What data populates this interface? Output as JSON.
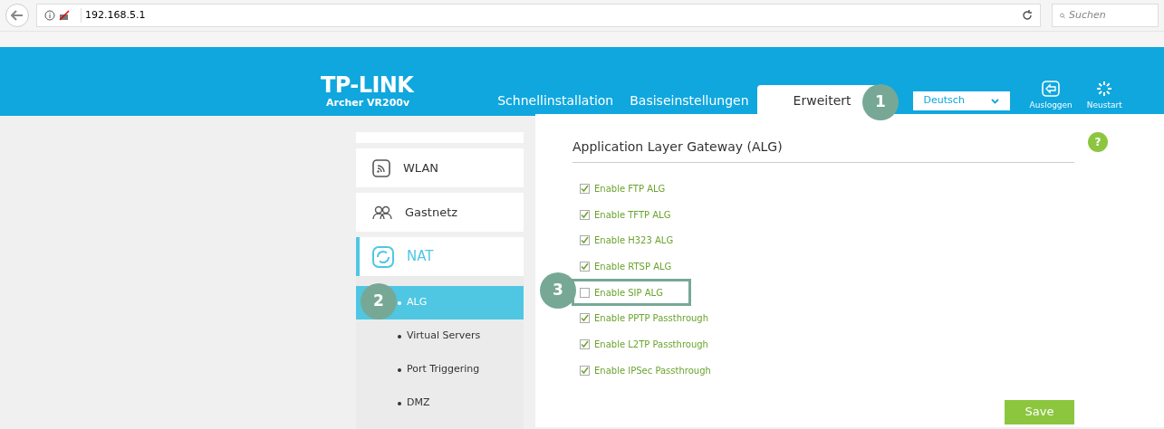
{
  "browser": {
    "url": "192.168.5.1",
    "search_placeholder": "Suchen"
  },
  "header": {
    "logo": "TP-LINK",
    "model": "Archer VR200v",
    "tabs": [
      {
        "label": "Schnellinstallation",
        "selected": false
      },
      {
        "label": "Basiseinstellungen",
        "selected": false
      },
      {
        "label": "Erweitert",
        "selected": true
      }
    ],
    "language": "Deutsch",
    "actions": [
      {
        "kind": "logout",
        "label": "Ausloggen"
      },
      {
        "kind": "reboot",
        "label": "Neustart"
      }
    ]
  },
  "sidebar": {
    "items": [
      {
        "kind": "partial"
      },
      {
        "kind": "wlan",
        "label": "WLAN",
        "active": false
      },
      {
        "kind": "guest",
        "label": "Gastnetz",
        "active": false
      },
      {
        "kind": "nat",
        "label": "NAT",
        "active": true,
        "children": [
          {
            "label": "ALG",
            "selected": true
          },
          {
            "label": "Virtual Servers",
            "selected": false
          },
          {
            "label": "Port Triggering",
            "selected": false
          },
          {
            "label": "DMZ",
            "selected": false
          }
        ]
      }
    ]
  },
  "content": {
    "title": "Application Layer Gateway (ALG)",
    "options": [
      {
        "label": "Enable FTP ALG",
        "checked": true,
        "highlighted": false
      },
      {
        "label": "Enable TFTP ALG",
        "checked": true,
        "highlighted": false
      },
      {
        "label": "Enable H323 ALG",
        "checked": true,
        "highlighted": false
      },
      {
        "label": "Enable RTSP ALG",
        "checked": true,
        "highlighted": false
      },
      {
        "label": "Enable SIP ALG",
        "checked": false,
        "highlighted": true
      },
      {
        "label": "Enable PPTP Passthrough",
        "checked": true,
        "highlighted": false
      },
      {
        "label": "Enable L2TP Passthrough",
        "checked": true,
        "highlighted": false
      },
      {
        "label": "Enable IPSec Passthrough",
        "checked": true,
        "highlighted": false
      }
    ],
    "help": "?",
    "save": "Save"
  },
  "callouts": [
    {
      "label": "1"
    },
    {
      "label": "2"
    },
    {
      "label": "3"
    }
  ]
}
